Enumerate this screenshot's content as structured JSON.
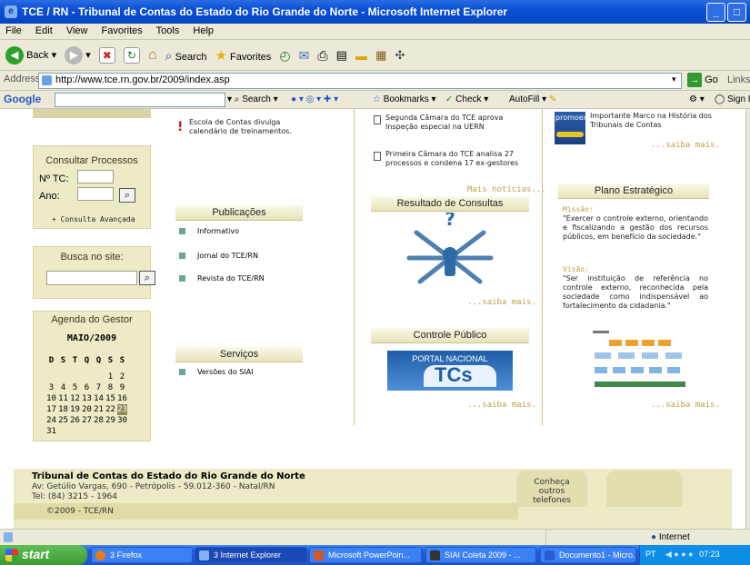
{
  "window": {
    "title": "TCE / RN - Tribunal de Contas do Estado do Rio Grande do Norte - Microsoft Internet Explorer",
    "minimize": "_",
    "maximize": "□"
  },
  "menu": [
    "File",
    "Edit",
    "View",
    "Favorites",
    "Tools",
    "Help"
  ],
  "toolbar": {
    "back": "Back",
    "search": "Search",
    "favorites": "Favorites"
  },
  "address": {
    "label": "Address",
    "url": "http://www.tce.rn.gov.br/2009/index.asp",
    "go": "Go",
    "links": "Links"
  },
  "googlebar": {
    "logo": "Google",
    "search": "Search",
    "bookmarks": "Bookmarks",
    "check": "Check",
    "autofill": "AutoFill",
    "signin": "Sign In"
  },
  "sidebar": {
    "consultar": {
      "title": "Consultar Processos",
      "tc_label": "Nº TC:",
      "ano_label": "Ano:",
      "advanced": "+ Consulta Avançada"
    },
    "busca": {
      "title": "Busca no site:"
    },
    "agenda": {
      "title": "Agenda do Gestor",
      "month": "MAIO/2009",
      "weekdays": [
        "D",
        "S",
        "T",
        "Q",
        "Q",
        "S",
        "S"
      ],
      "weeks": [
        [
          "",
          "",
          "",
          "",
          "",
          "1",
          "2"
        ],
        [
          "3",
          "4",
          "5",
          "6",
          "7",
          "8",
          "9"
        ],
        [
          "10",
          "11",
          "12",
          "13",
          "14",
          "15",
          "16"
        ],
        [
          "17",
          "18",
          "19",
          "20",
          "21",
          "22",
          "23"
        ],
        [
          "24",
          "25",
          "26",
          "27",
          "28",
          "29",
          "30"
        ],
        [
          "31",
          "",
          "",
          "",
          "",
          "",
          ""
        ]
      ],
      "today": "23"
    }
  },
  "col2": {
    "escola": "Escola de Contas divulga calendário de treinamentos.",
    "publicacoes": {
      "title": "Publicações",
      "items": [
        "Informativo",
        "Jornal do TCE/RN",
        "Revista do TCE/RN"
      ]
    },
    "servicos": {
      "title": "Serviços",
      "items": [
        "Versões do SIAI"
      ]
    }
  },
  "col3": {
    "news": [
      "Segunda Câmara do TCE aprova Inspeção especial na UERN",
      "Primeira Câmara do TCE analisa 27 processos e condena 17 ex-gestores"
    ],
    "mais": "Mais notícias...",
    "resultado": "Resultado de Consultas",
    "saiba1": "...saiba mais.",
    "controle": "Controle Público",
    "portal_top": "PORTAL NACIONAL",
    "portal_main": "TCs",
    "saiba2": "...saiba mais."
  },
  "col4": {
    "promoex": "promoex",
    "marco": "Importante Marco na História dos Tribunais de Contas",
    "saiba1": "...saiba mais.",
    "plano": "Plano Estratégico",
    "missao_label": "Missão:",
    "missao": "\"Exercer o controle externo, orientando e fiscalizando a gestão dos recursos públicos, em benefício da sociedade.\"",
    "visao_label": "Visão:",
    "visao": "\"Ser instituição de referência no controle externo, reconhecida pela sociedade como indispensável ao fortalecimento da cidadania.\"",
    "saiba2": "...saiba mais."
  },
  "footer": {
    "name": "Tribunal de Contas do Estado do Rio Grande do Norte",
    "address": "Av: Getúlio Vargas, 690 - Petrópolis - 59.012-360 - Natal/RN",
    "tel": "Tel: (84) 3215 - 1964",
    "copyright": "©2009 - TCE/RN",
    "conheca": "Conheça outros telefones"
  },
  "status": {
    "zone": "Internet"
  },
  "taskbar": {
    "start": "start",
    "tasks": [
      "3 Firefox",
      "3 Internet Explorer",
      "Microsoft PowerPoin...",
      "SIAI Coleta 2009 - ...",
      "Documento1 - Micro..."
    ],
    "lang": "PT",
    "clock": "07:23"
  },
  "colors": {
    "accent_gold": "#b8a24a",
    "panel_bg": "#ecebc6",
    "xp_blue": "#245edb"
  }
}
